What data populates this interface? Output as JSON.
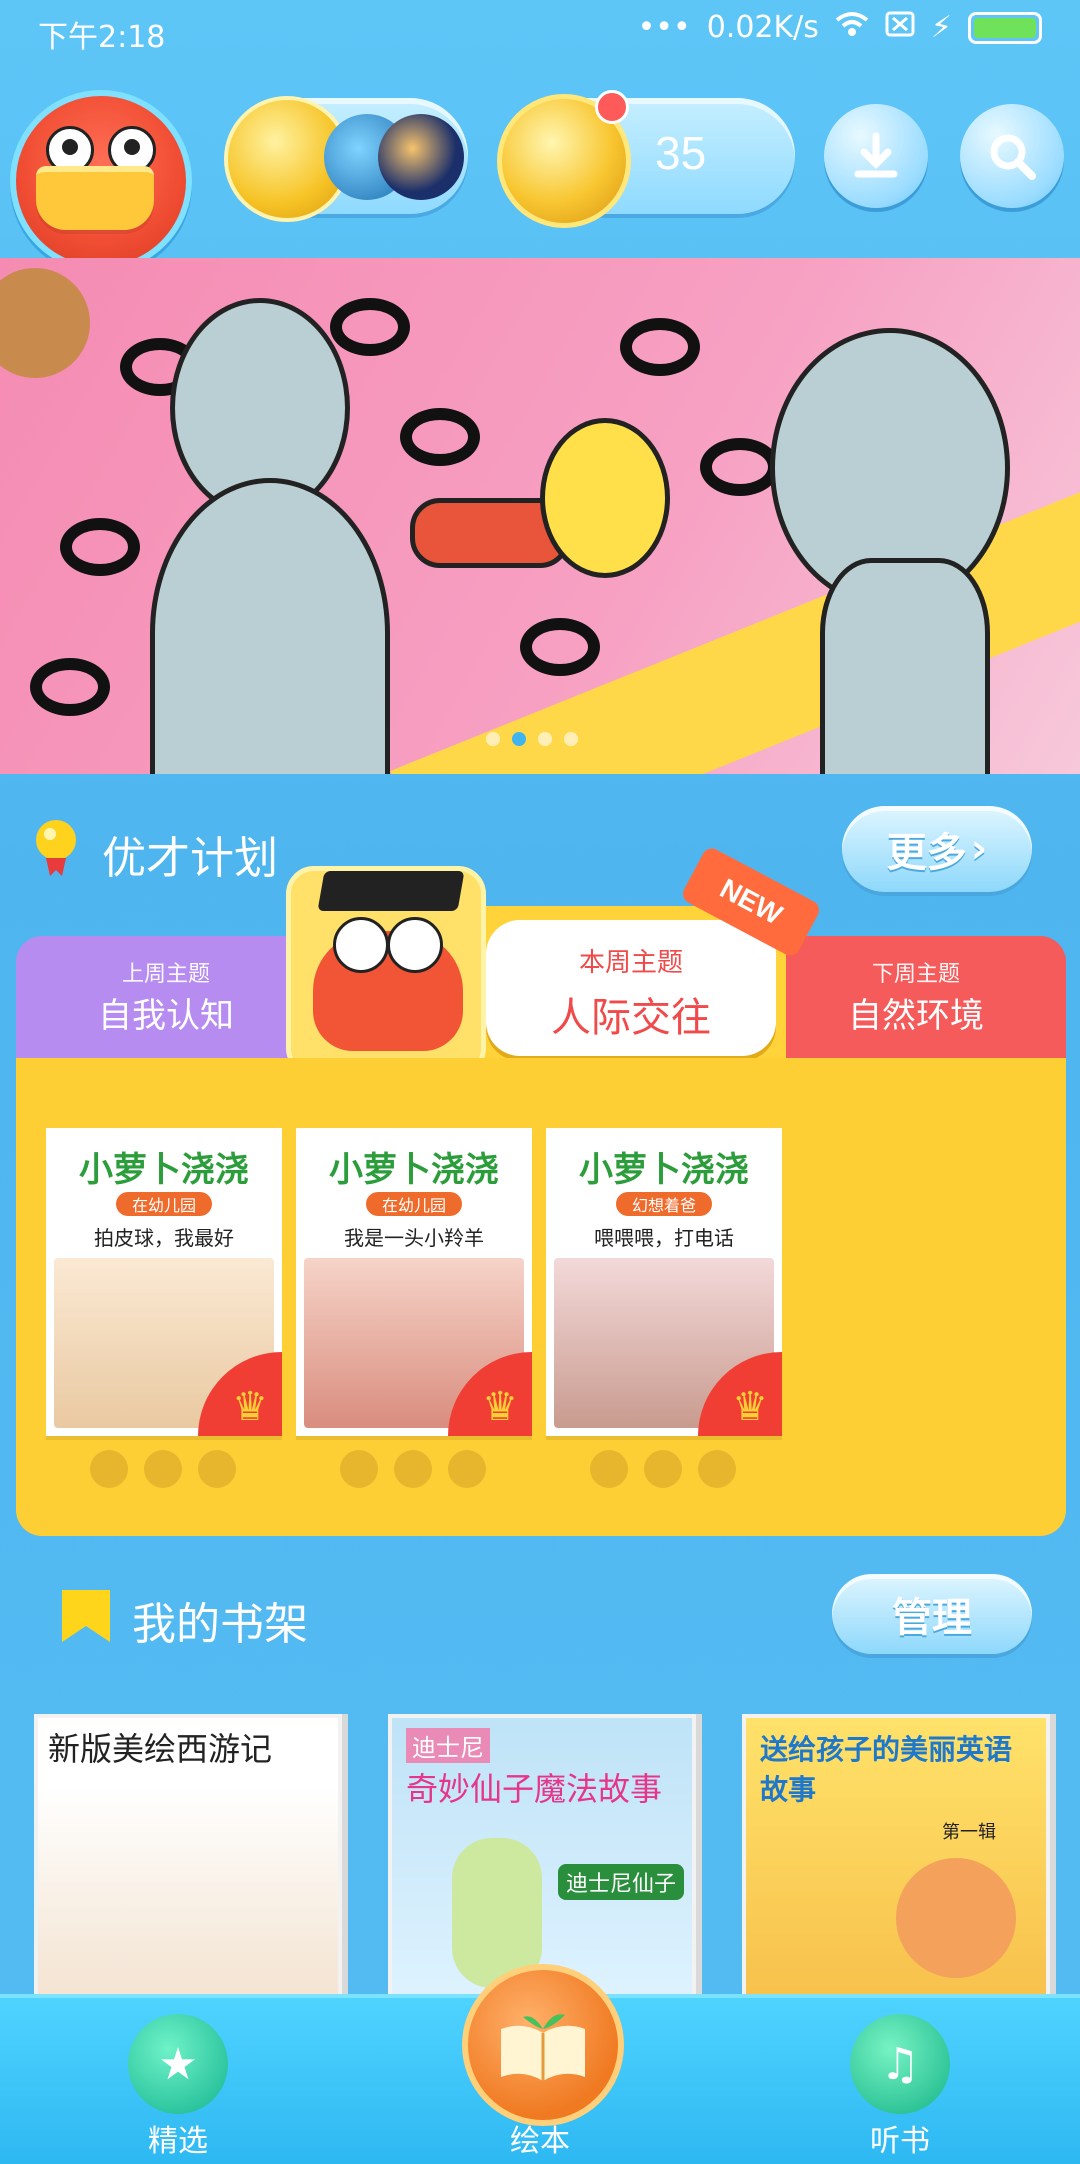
{
  "status_bar": {
    "time": "下午2:18",
    "network_speed": "0.02K/s"
  },
  "header": {
    "coin_count": "35"
  },
  "talent_plan": {
    "title": "优才计划",
    "more_label": "更多",
    "last_week": {
      "caption": "上周主题",
      "theme": "自我认知"
    },
    "this_week": {
      "caption": "本周主题",
      "theme": "人际交往",
      "badge": "NEW"
    },
    "next_week": {
      "caption": "下周主题",
      "theme": "自然环境"
    },
    "books": [
      {
        "series": "小萝卜浇浇",
        "level": "在幼儿园",
        "title": "拍皮球，我最好"
      },
      {
        "series": "小萝卜浇浇",
        "level": "在幼儿园",
        "title": "我是一头小羚羊"
      },
      {
        "series": "小萝卜浇浇",
        "level": "幻想着爸",
        "title": "喂喂喂，打电话"
      }
    ]
  },
  "bookshelf": {
    "title": "我的书架",
    "manage_label": "管理",
    "books": [
      {
        "title": "新版美绘西游记"
      },
      {
        "title": "奇妙仙子魔法故事",
        "brand": "迪士尼",
        "sub": "迪士尼仙子"
      },
      {
        "title": "送给孩子的美丽英语故事",
        "sub": "第一辑"
      }
    ]
  },
  "bottom_nav": {
    "items": [
      {
        "label": "精选"
      },
      {
        "label": "绘本"
      },
      {
        "label": "听书"
      }
    ]
  },
  "colors": {
    "accent_blue": "#4fb5ef",
    "panel_yellow": "#fece35",
    "tab_purple": "#b68cf0",
    "tab_red": "#f55b5b"
  }
}
